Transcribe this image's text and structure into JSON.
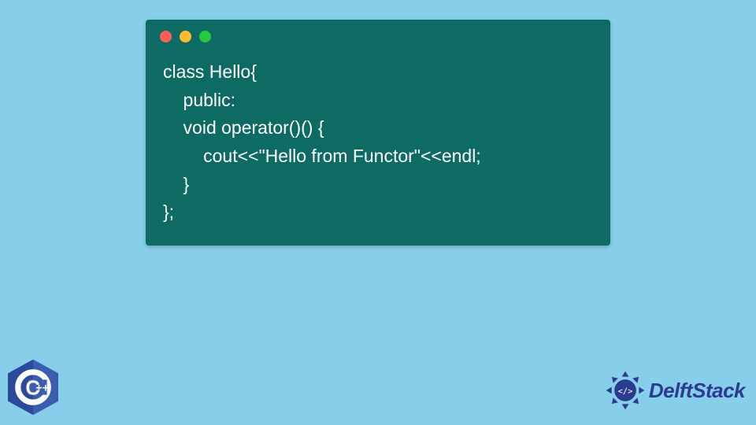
{
  "code": {
    "lines": [
      "class Hello{",
      "    public:",
      "    void operator()() {",
      "        cout<<\"Hello from Functor\"<<endl;",
      "    }",
      "};"
    ]
  },
  "window": {
    "dot_colors": {
      "red": "#ff5f57",
      "yellow": "#febc2e",
      "green": "#28c840"
    },
    "bg": "#0e6b63"
  },
  "page_bg": "#87ceeb",
  "cpp_badge": {
    "label": "C++",
    "color": "#2b4a9b"
  },
  "brand": {
    "name": "DelftStack",
    "color": "#2b3b8f"
  }
}
